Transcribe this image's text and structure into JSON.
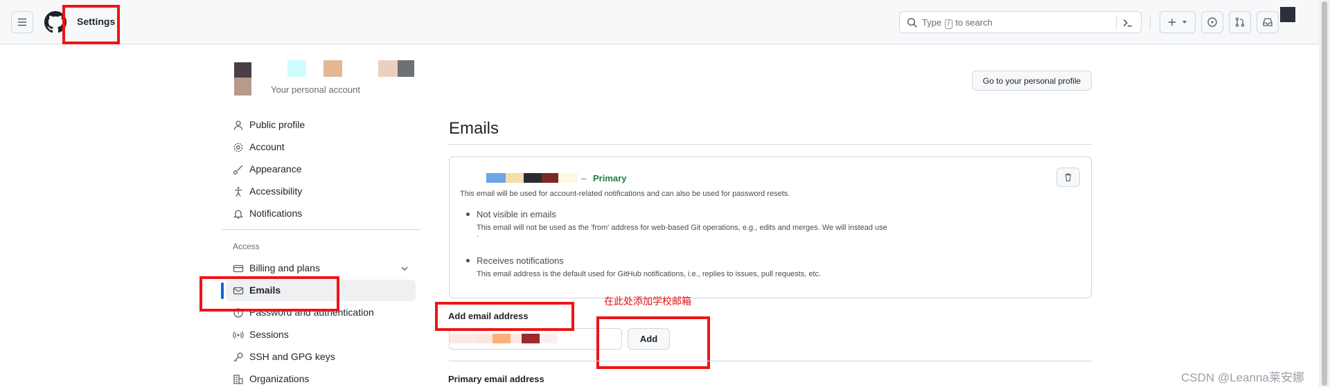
{
  "header": {
    "context_title": "Settings",
    "search": {
      "prefix": "Type",
      "key": "/",
      "suffix": "to search"
    }
  },
  "profile": {
    "subtitle": "Your personal account",
    "go_button": "Go to your personal profile"
  },
  "sidebar": {
    "items": [
      {
        "label": "Public profile",
        "icon": "person-icon"
      },
      {
        "label": "Account",
        "icon": "gear-icon"
      },
      {
        "label": "Appearance",
        "icon": "paintbrush-icon"
      },
      {
        "label": "Accessibility",
        "icon": "accessibility-icon"
      },
      {
        "label": "Notifications",
        "icon": "bell-icon"
      }
    ],
    "access_heading": "Access",
    "access_items": [
      {
        "label": "Billing and plans",
        "icon": "credit-card-icon"
      },
      {
        "label": "Emails",
        "icon": "mail-icon",
        "active": true
      },
      {
        "label": "Password and authentication",
        "icon": "shield-lock-icon"
      },
      {
        "label": "Sessions",
        "icon": "broadcast-icon"
      },
      {
        "label": "SSH and GPG keys",
        "icon": "key-icon"
      },
      {
        "label": "Organizations",
        "icon": "organization-icon"
      }
    ]
  },
  "main": {
    "title": "Emails",
    "primary_email": {
      "dash": "–",
      "badge": "Primary",
      "description": "This email will be used for account-related notifications and can also be used for password resets.",
      "bullets": [
        {
          "title": "Not visible in emails",
          "text": "This email will not be used as the 'from' address for web-based Git operations, e.g., edits and merges. We will instead use",
          "text2": "."
        },
        {
          "title": "Receives notifications",
          "text": "This email address is the default used for GitHub notifications, i.e., replies to issues, pull requests, etc."
        }
      ]
    },
    "add_email": {
      "label": "Add email address",
      "button": "Add",
      "annotation": "在此处添加学校邮箱"
    },
    "primary_section_title": "Primary email address"
  },
  "watermark": "CSDN @Leanna莱安娜",
  "colors": {
    "accent": "#0969da",
    "primary_green": "#1a7f37",
    "annotation_red": "#f01414"
  }
}
